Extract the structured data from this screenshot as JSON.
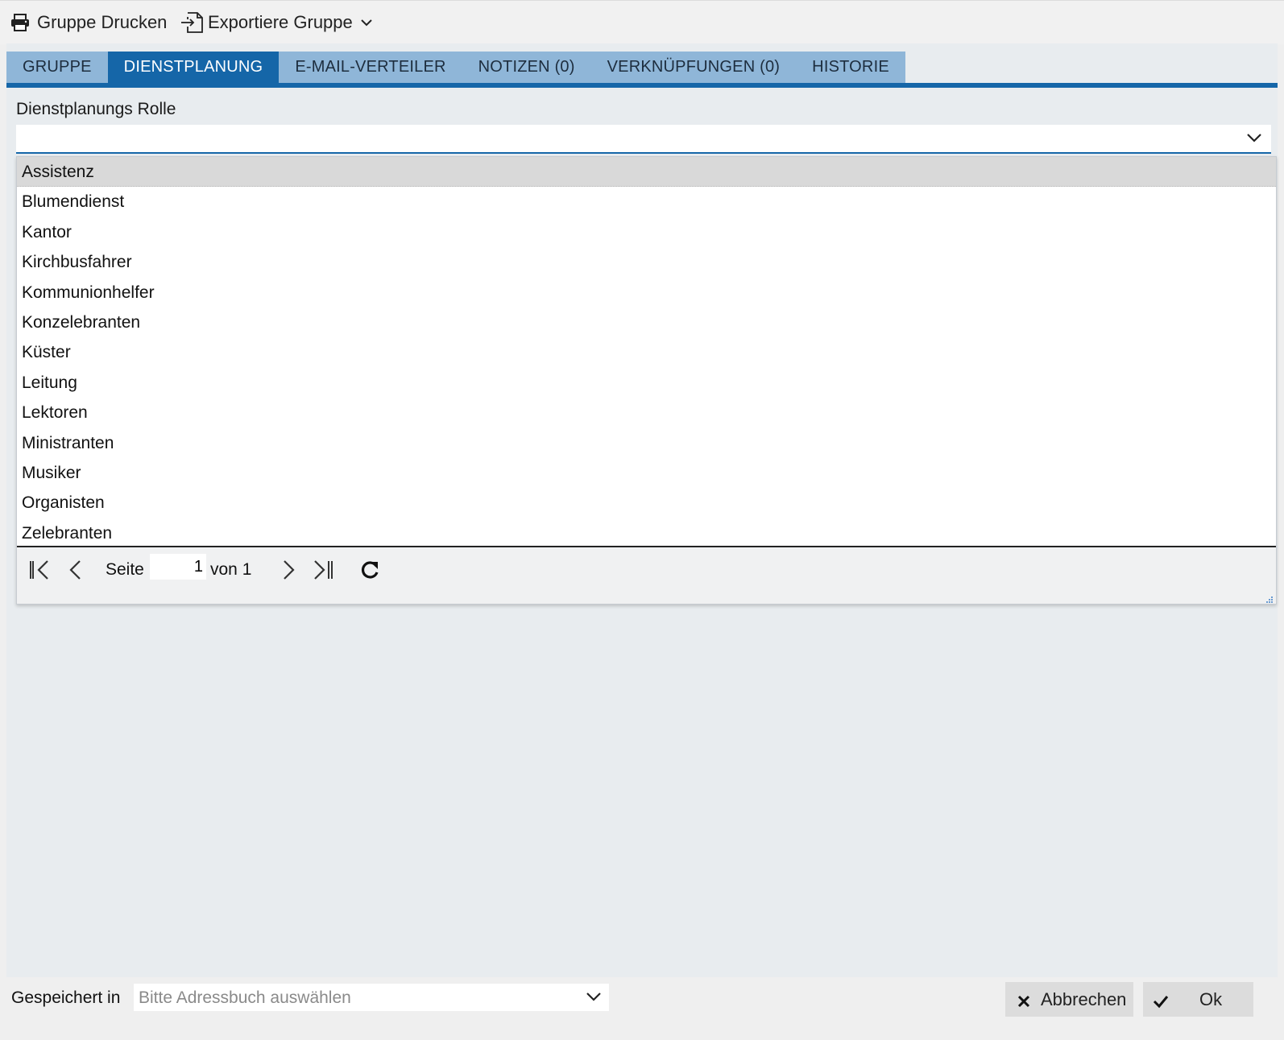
{
  "toolbar": {
    "print_label": "Gruppe Drucken",
    "export_label": "Exportiere Gruppe"
  },
  "tabs": [
    {
      "label": "GRUPPE",
      "active": false
    },
    {
      "label": "DIENSTPLANUNG",
      "active": true
    },
    {
      "label": "E-MAIL-VERTEILER",
      "active": false
    },
    {
      "label": "NOTIZEN (0)",
      "active": false
    },
    {
      "label": "VERKNÜPFUNGEN (0)",
      "active": false
    },
    {
      "label": "HISTORIE",
      "active": false
    }
  ],
  "form": {
    "role_label": "Dienstplanungs Rolle",
    "role_value": ""
  },
  "dropdown": {
    "selected_index": 0,
    "items": [
      "Assistenz",
      "Blumendienst",
      "Kantor",
      "Kirchbusfahrer",
      "Kommunionhelfer",
      "Konzelebranten",
      "Küster",
      "Leitung",
      "Lektoren",
      "Ministranten",
      "Musiker",
      "Organisten",
      "Zelebranten"
    ],
    "pager": {
      "page_label": "Seite",
      "page_value": "1",
      "of_label": "von 1"
    }
  },
  "footer": {
    "saved_in_label": "Gespeichert in",
    "addressbook_placeholder": "Bitte Adressbuch auswählen",
    "cancel_label": "Abbrechen",
    "ok_label": "Ok"
  },
  "colors": {
    "accent": "#1566a8",
    "tab_inactive": "#8fb6d8",
    "panel_bg": "#e8ecef",
    "selected_row": "#d9d9d9"
  }
}
